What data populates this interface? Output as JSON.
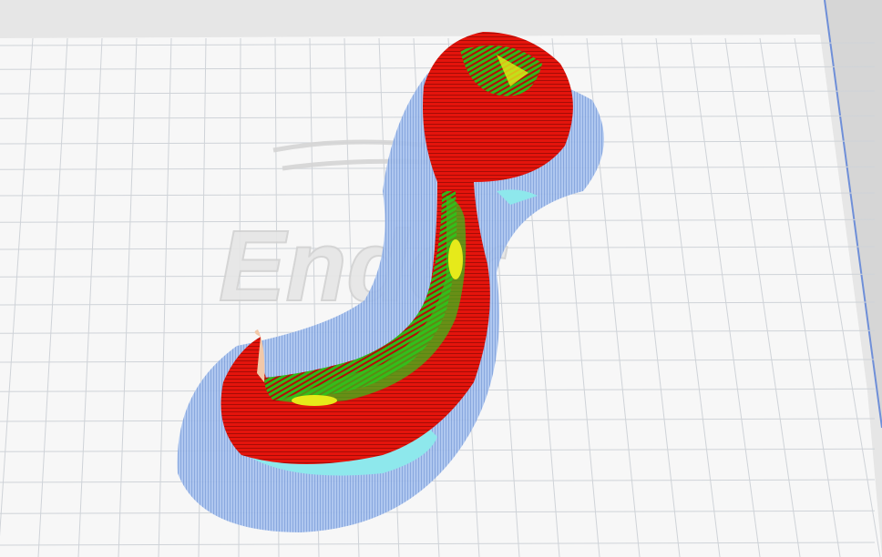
{
  "view": {
    "name": "slicer-layer-preview",
    "watermark_logo_text": "Ender",
    "colors": {
      "bed": "#f7f7f7",
      "bed_border": "#c8c8c8",
      "grid": "#cfd3d8",
      "bed_edge": "#6f8fd8",
      "shell": "#e4140c",
      "shell_dark": "#a50c06",
      "infill": "#33c21a",
      "top_skin": "#e6ea1a",
      "support_shadow": "#9fbcec",
      "support": "#8ee8ec"
    }
  }
}
